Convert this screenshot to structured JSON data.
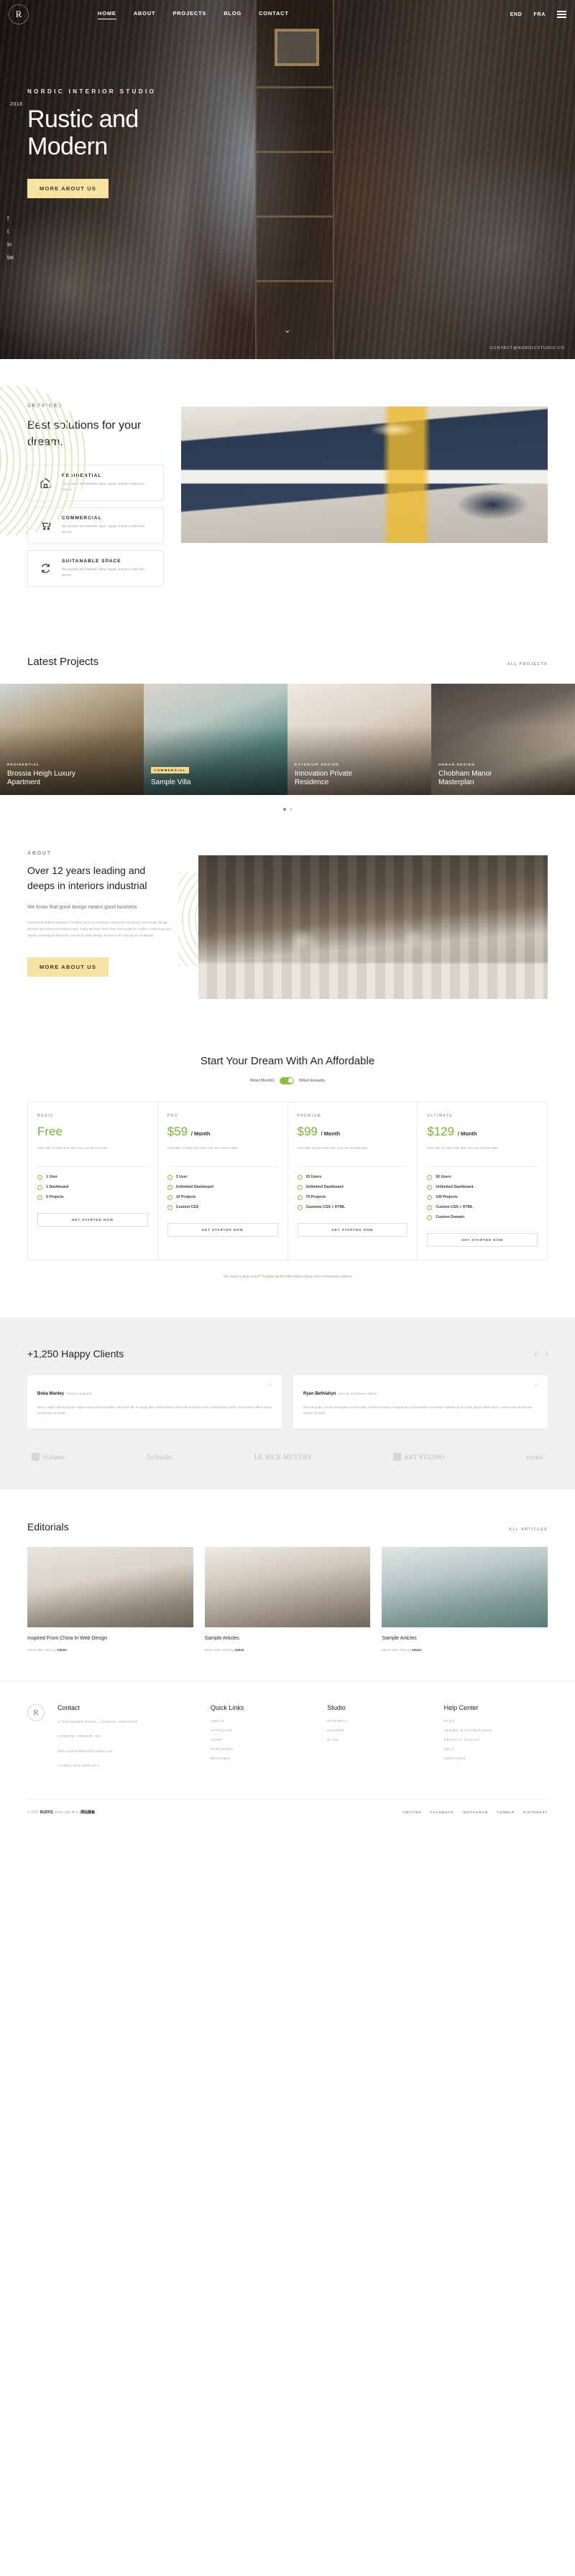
{
  "header": {
    "logo": "R",
    "nav": [
      {
        "label": "HOME",
        "active": true
      },
      {
        "label": "ABOUT",
        "active": false
      },
      {
        "label": "PROJECTS",
        "active": false
      },
      {
        "label": "BLOG",
        "active": false
      },
      {
        "label": "CONTACT",
        "active": false
      }
    ],
    "lang_primary": "END",
    "lang_secondary": "FRA",
    "menu_icon": "hamburger-icon"
  },
  "hero": {
    "year": "2018",
    "kicker": "NORDIC INTERIOR STUDIO",
    "title": "Rustic and Modern",
    "cta": "MORE ABOUT US",
    "social": [
      "f",
      "t",
      "in",
      "be"
    ],
    "contact": "CONTACT@NORDICSTUDIO.CO",
    "scroll_icon": "chevron-down-icon"
  },
  "services": {
    "eyebrow": "SERVICES",
    "title": "Best solutions for your dream.",
    "cards": [
      {
        "icon": "home-icon",
        "title": "RESIDENTIAL",
        "desc": "We provide all materials, labor, equal, ensure a safe and secure"
      },
      {
        "icon": "cart-icon",
        "title": "COMMERCIAL",
        "desc": "We provide all materials, labor, equal, ensure a safe and secure"
      },
      {
        "icon": "recycle-icon",
        "title": "SUITANABLE SPACE",
        "desc": "We provide all materials, labor, equal, ensure a safe and secure"
      }
    ]
  },
  "projects": {
    "title": "Latest Projects",
    "all_link": "ALL PROJECTS",
    "items": [
      {
        "category": "RESIDENTIAL",
        "name": "Brossia Heigh Luxury Apartment",
        "badge": false
      },
      {
        "category": "COMMERCIAL",
        "name": "Sample Villa",
        "badge": true
      },
      {
        "category": "EXTERIOR DESIGN",
        "name": "Innovation Private Residence",
        "badge": false
      },
      {
        "category": "URBAN DESIGN",
        "name": "Chobham Manor Masterplan",
        "badge": false
      }
    ]
  },
  "about": {
    "eyebrow": "ABOUT",
    "title": "Over 12 years leading and deeps in interiors industrial",
    "subtitle": "We know that good design means good business",
    "paragraph": "Founded by Robert Downey Jr in 2004, we're an employee owned firm pursuing a democratic design process that values everyone's input. Today we have more than 150 people in London, Hong Kong and Sydney providing architecture, interior & urban design services from concept to completion.",
    "cta": "MORE ABOUT US"
  },
  "pricing": {
    "title": "Start Your Dream With An Affordable",
    "billing_monthly": "Billed Monthly",
    "billing_annual": "Billed Annually",
    "note_text": "You have a large team?",
    "note_link": "Contact us",
    "note_tail": "for information about more enterprise options",
    "plans": [
      {
        "tier": "BASIC",
        "price": "Free",
        "period": "",
        "desc": "Free with 14 days trial, then you can choose plan",
        "features": [
          "1 User",
          "1 Dashboard",
          "5 Projects"
        ],
        "cta": "GET STARTED NOW"
      },
      {
        "tier": "PRO",
        "price": "$59",
        "period": "/ Month",
        "desc": "Free with 14 days trial, then you can choose plan",
        "features": [
          "3 User",
          "Unlimited Dashboard",
          "10 Projects",
          "Custom CSS"
        ],
        "cta": "GET STARTED NOW"
      },
      {
        "tier": "PREMIUM",
        "price": "$99",
        "period": "/ Month",
        "desc": "Free with 14 days trial, then you can choose plan",
        "features": [
          "20 Users",
          "Unlimited Dashboard",
          "70 Projects",
          "Customs CSS + HTML"
        ],
        "cta": "GET STARTED NOW"
      },
      {
        "tier": "ULTIMATE",
        "price": "$129",
        "period": "/ Month",
        "desc": "Free with 14 days trial, then you can choose plan",
        "features": [
          "50 Users",
          "Unlimited Dashboard",
          "100 Projects",
          "Custom CSS + HTML",
          "Custom Domain"
        ],
        "cta": "GET STARTED NOW"
      }
    ]
  },
  "testimonials": {
    "title": "+1,250 Happy Clients",
    "prev_icon": "chevron-left-icon",
    "next_icon": "chevron-right-icon",
    "items": [
      {
        "name": "Boba Manley",
        "role": "Director at Spotify",
        "text": "We've made call and quick, issues and remark lot when call a less tilt, at magni dive locked future commodo molestie turns curabi ipsum cheer! Dolor lorma tellus acuris sed tempor sit amet."
      },
      {
        "name": "Ryan Bethlahyn",
        "role": "Director at Evidence Manor",
        "text": "Sed elit quam, iaculis sed sapien at eros nibh. Sollers innovas ut magna leo consectetuer commodo molestie turns curabi ipsum ullam dolor. Lorem tellus acuris sed tempor sit amet."
      }
    ],
    "brands": [
      "Villatex",
      "firStudio",
      "LE BICK MEYERS",
      "ART STUDIO",
      "cronit"
    ]
  },
  "editorials": {
    "title": "Editorials",
    "all_link": "ALL ARTICLES",
    "articles": [
      {
        "title": "Inspired From China In Web Design",
        "date": "March 25th, 2023",
        "by": "by",
        "author": "Admin"
      },
      {
        "title": "Sample Articles",
        "date": "March 25th, 2023",
        "by": "by",
        "author": "Admin"
      },
      {
        "title": "Sample Articles",
        "date": "March 25th, 2023",
        "by": "by",
        "author": "Admin"
      }
    ]
  },
  "footer": {
    "logo": "R",
    "contact": {
      "heading": "Contact",
      "address_line1": "17 PRINCESS ROAD, LONDON, GREATER",
      "address_line2": "LONDON, NW18JR, UK",
      "email": "HELLO@NORDICSTUDIO.CO",
      "phone": "(+0084) 912-3548-073"
    },
    "quick_links": {
      "heading": "Quick Links",
      "items": [
        "ABOUT",
        "AFFILIATE",
        "SHOP",
        "PARTNERS",
        "REVIEWS"
      ]
    },
    "studio": {
      "heading": "Studio",
      "items": [
        "PROJECT",
        "CAREER",
        "BLOG"
      ]
    },
    "help": {
      "heading": "Help Center",
      "items": [
        "FAQS",
        "TERMS & CONDITIONS",
        "PRIVACY POLICY",
        "HELP",
        "SERVICES"
      ]
    },
    "copyright_prefix": "© 2025",
    "copyright_brand": "RUSTIC",
    "copyright_mid": "Made with",
    "copyright_by": "by",
    "copyright_author": "网站模板",
    "socials": [
      "TWITTER",
      "FACEBOOK",
      "INSTAGRAM",
      "TUMBLR",
      "PINTEREST"
    ]
  }
}
